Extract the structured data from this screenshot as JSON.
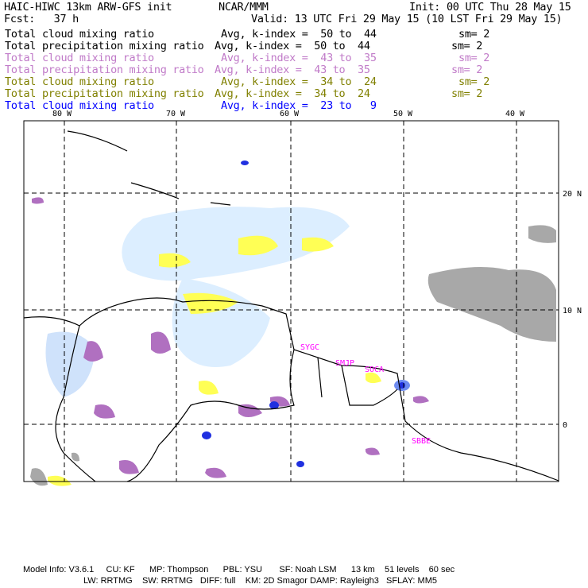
{
  "header": {
    "title": "HAIC-HIWC 13km ARW-GFS init",
    "org": "NCAR/MMM",
    "init": "Init: 00 UTC Thu 28 May 15",
    "fcst": "Fcst:   37 h",
    "valid": "Valid: 13 UTC Fri 29 May 15 (10 LST Fri 29 May 15)"
  },
  "legend": [
    {
      "field": "Total cloud mixing ratio",
      "range": "Avg, k-index =  50 to  44",
      "sm": "sm= 2",
      "color": "#000000"
    },
    {
      "field": "Total precipitation mixing ratio",
      "range": "Avg, k-index =  50 to  44",
      "sm": "sm= 2",
      "color": "#000000"
    },
    {
      "field": "Total cloud mixing ratio",
      "range": "Avg, k-index =  43 to  35",
      "sm": "sm= 2",
      "color": "#c07ac8"
    },
    {
      "field": "Total precipitation mixing ratio",
      "range": "Avg, k-index =  43 to  35",
      "sm": "sm= 2",
      "color": "#c07ac8"
    },
    {
      "field": "Total cloud mixing ratio",
      "range": "Avg, k-index =  34 to  24",
      "sm": "sm= 2",
      "color": "#808000"
    },
    {
      "field": "Total precipitation mixing ratio",
      "range": "Avg, k-index =  34 to  24",
      "sm": "sm= 2",
      "color": "#808000"
    },
    {
      "field": "Total cloud mixing ratio",
      "range": "Avg, k-index =  23 to   9",
      "color": "#0000ff"
    }
  ],
  "map": {
    "lon_labels": [
      "80 W",
      "70 W",
      "60 W",
      "50 W",
      "40 W"
    ],
    "lat_labels": [
      "20 N",
      "10 N",
      "0"
    ],
    "stations": [
      "SYGC",
      "SMJP",
      "SOCA",
      "SBBE"
    ]
  },
  "footer": {
    "line1": "Model Info: V3.6.1     CU: KF      MP: Thompson      PBL: YSU       SF: Noah LSM      13 km    51 levels    60 sec",
    "line2": "LW: RRTMG    SW: RRTMG   DIFF: full    KM: 2D Smagor DAMP: Rayleigh3   SFLAY: MM5"
  }
}
